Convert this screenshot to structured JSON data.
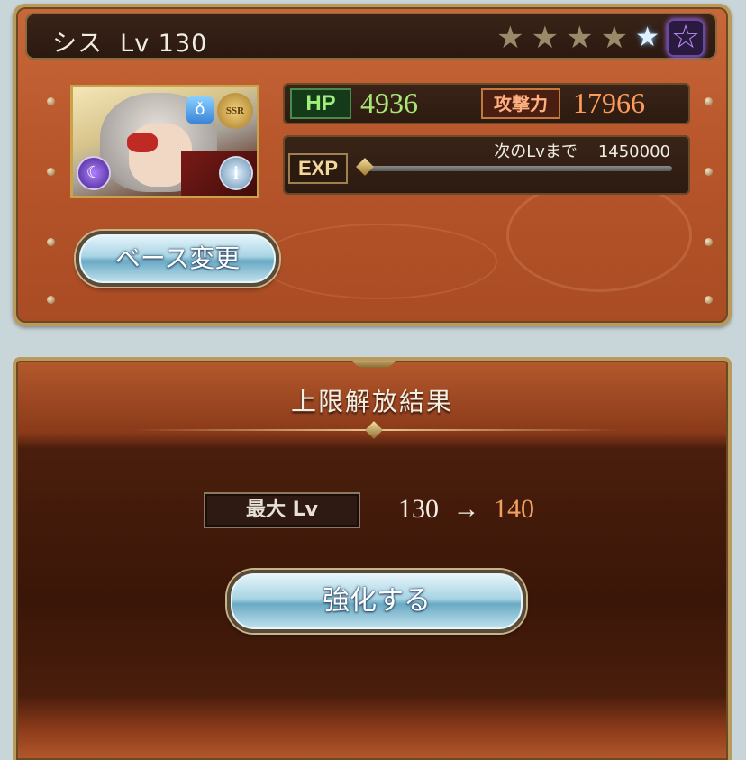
{
  "character": {
    "name": "シス",
    "level_label": "Lv",
    "level": "130",
    "stars": [
      "star-bronze",
      "star-bronze",
      "star-bronze",
      "star-bronze",
      "star-blue",
      "star-purple"
    ],
    "rarity_badge": "SSR",
    "element": "dark",
    "hp_label": "HP",
    "hp": "4936",
    "atk_label": "攻撃力",
    "atk": "17966",
    "exp_label": "EXP",
    "next_lv_text": "次のLvまで",
    "next_lv_exp": "1450000",
    "exp_progress": 0.0
  },
  "buttons": {
    "base_change": "ベース変更",
    "enhance": "強化する"
  },
  "result": {
    "title": "上限解放結果",
    "max_lv_label": "最大 Lv",
    "from_level": "130",
    "arrow": "→",
    "to_level": "140"
  },
  "colors": {
    "hp_value": "#a6e874",
    "atk_value": "#ff9a5a",
    "new_level": "#f2a060",
    "panel": "#b8562b"
  }
}
